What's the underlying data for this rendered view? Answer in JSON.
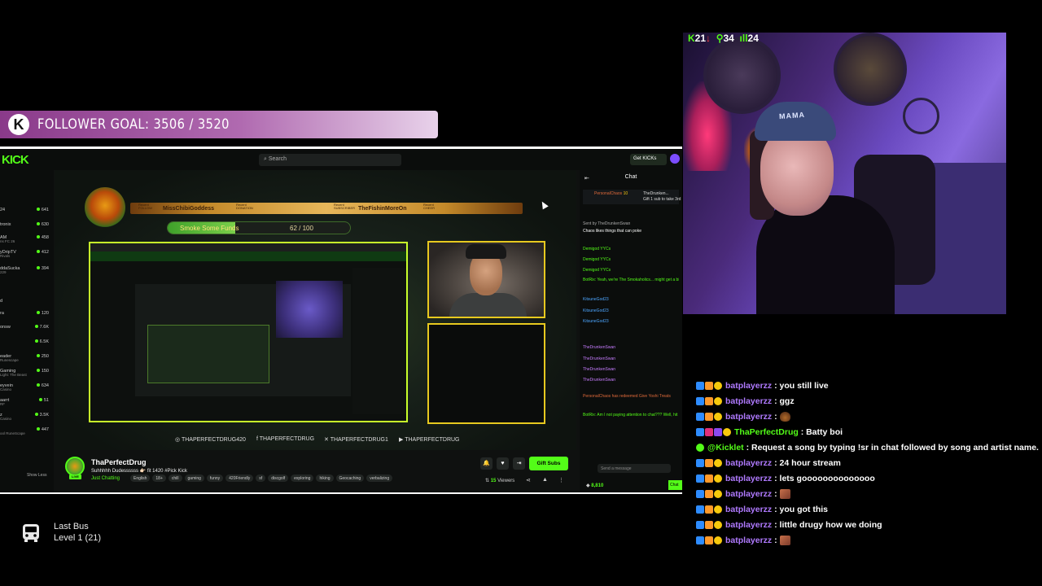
{
  "goal": {
    "text": "FOLLOWER GOAL: 3506 / 3520",
    "icon": "kick-k-icon",
    "current": 3506,
    "target": 3520
  },
  "kick_page": {
    "logo": "KICK",
    "search_placeholder": "Search",
    "get_kicks": "Get KICKs",
    "sidebar": [
      {
        "name": "24",
        "viewers": "641"
      },
      {
        "name": "tronix",
        "viewers": "630"
      },
      {
        "name": "AM",
        "sub": "ns FC 26",
        "viewers": "458"
      },
      {
        "name": "yDripTV",
        "sub": "Rivals",
        "viewers": "412"
      },
      {
        "name": "ddaSucka",
        "sub": "229",
        "viewers": "394"
      },
      {
        "name": "d",
        "viewers": ""
      },
      {
        "name": "ra",
        "viewers": "120"
      },
      {
        "name": "onsw",
        "viewers": "7.6K"
      },
      {
        "name": "",
        "viewers": "6.5K"
      },
      {
        "name": "eader",
        "sub": "Runescape",
        "viewers": "250"
      },
      {
        "name": "Gaming",
        "sub": "Light: The Beast",
        "viewers": "150"
      },
      {
        "name": "eyvein",
        "sub": "Casino",
        "viewers": "634"
      },
      {
        "name": "aarrt",
        "sub": "RF",
        "viewers": "51"
      },
      {
        "name": "z",
        "sub": "Casino",
        "viewers": "3.5K"
      },
      {
        "name": "",
        "sub": "ool RuneScape",
        "viewers": "447"
      }
    ],
    "show_less": "Show Less",
    "alerts": [
      {
        "cap": "Recent FOLLOW",
        "name": "MissChibiGoddess"
      },
      {
        "cap": "Recent DONATION",
        "name": ""
      },
      {
        "cap": "Recent SUBSCRIBER",
        "name": "TheFishinMoreOn"
      },
      {
        "cap": "Recent CHEER",
        "name": ""
      }
    ],
    "smoke": {
      "label": "Smoke Some Funds",
      "amount": "62 / 100",
      "fraction": 0.62
    },
    "socials": [
      {
        "icon": "instagram-icon",
        "text": "THAPERFECTDRUG420"
      },
      {
        "icon": "facebook-icon",
        "text": "THAPERFECTDRUG"
      },
      {
        "icon": "twitter-icon",
        "text": "THAPERFECTDRUG1"
      },
      {
        "icon": "youtube-icon",
        "text": "THAPERFECTDRUG"
      }
    ],
    "channel": {
      "name": "ThaPerfectDrug",
      "title": "Suhhhhh Dudessssss 👉🏻 fit 1420 #Pick Kick",
      "category": "Just Chatting",
      "live": "LIVE",
      "tags": [
        "English",
        "18+",
        "chill",
        "gaming",
        "funny",
        "420Friendly",
        "sf",
        "discgolf",
        "exploring",
        "hiking",
        "Geocaching",
        "verbalizing"
      ],
      "gift_subs": "Gift Subs",
      "viewers_count": "15",
      "viewers_label": "Viewers"
    },
    "chat": {
      "title": "Chat",
      "pinned_user": "PersonalChaos",
      "pinned_count": "10",
      "gift_line": "Gift 1 sub to take 3rd",
      "gift_user": "TheDrunken...",
      "chaos_line": "Chaos likes things that can poke",
      "sent_by": "Sent by TheDrunkenSwan",
      "lines": [
        {
          "u": "Demigod YYCs",
          "c": "u4"
        },
        {
          "u": "Demigod YYCs",
          "c": "u4"
        },
        {
          "u": "Demigod YYCs",
          "c": "u4"
        },
        {
          "u": "BotRix: Yeah, we're The Smokaholics... might get a bit cloudy in here!!!",
          "c": "u4"
        },
        {
          "u": "KitsuneGod23",
          "c": "u2"
        },
        {
          "u": "KitsuneGod23",
          "c": "u2"
        },
        {
          "u": "KitsuneGod23",
          "c": "u2"
        },
        {
          "u": "TheDrunkenSwan",
          "c": "u3"
        },
        {
          "u": "TheDrunkenSwan",
          "c": "u3"
        },
        {
          "u": "TheDrunkenSwan",
          "c": "u3"
        },
        {
          "u": "TheDrunkenSwan",
          "c": "u3"
        },
        {
          "u": "PersonalChaos has redeemed Give Yoshi Treats",
          "c": "u1"
        },
        {
          "u": "BotRix: Am I not paying attention to chat??? Well, hit me with a !lfts to let me know you're there!",
          "c": "u4"
        }
      ],
      "send_placeholder": "Send a message",
      "chat_button": "Chat",
      "bottom_stat": "8,810"
    }
  },
  "webcam": {
    "stats": {
      "k": "21",
      "a": "34",
      "b": "24"
    },
    "hat_text": "MAMA"
  },
  "overlay_chat": [
    {
      "user": "batplayerzz",
      "msg": ": you still live",
      "green": false
    },
    {
      "user": "batplayerzz",
      "msg": ": ggz",
      "green": false
    },
    {
      "user": "batplayerzz",
      "msg": ":",
      "green": false,
      "emote": "poop"
    },
    {
      "user": "ThaPerfectDrug",
      "msg": ": Batty boi",
      "green": true
    },
    {
      "user": "@Kicklet",
      "msg": ": Request a song by typing !sr in chat followed by song and artist name.",
      "green": true,
      "bot": true
    },
    {
      "user": "batplayerzz",
      "msg": ": 24 hour stream",
      "green": false
    },
    {
      "user": "batplayerzz",
      "msg": ": lets goooooooooooooo",
      "green": false
    },
    {
      "user": "batplayerzz",
      "msg": ":",
      "green": false,
      "emote": "face"
    },
    {
      "user": "batplayerzz",
      "msg": ": you got this",
      "green": false
    },
    {
      "user": "batplayerzz",
      "msg": ": little drugy how we doing",
      "green": false
    },
    {
      "user": "batplayerzz",
      "msg": ":",
      "green": false,
      "emote": "face"
    }
  ],
  "last_bus": {
    "title": "Last Bus",
    "level": "Level 1  (21)",
    "icon": "bus-icon"
  }
}
